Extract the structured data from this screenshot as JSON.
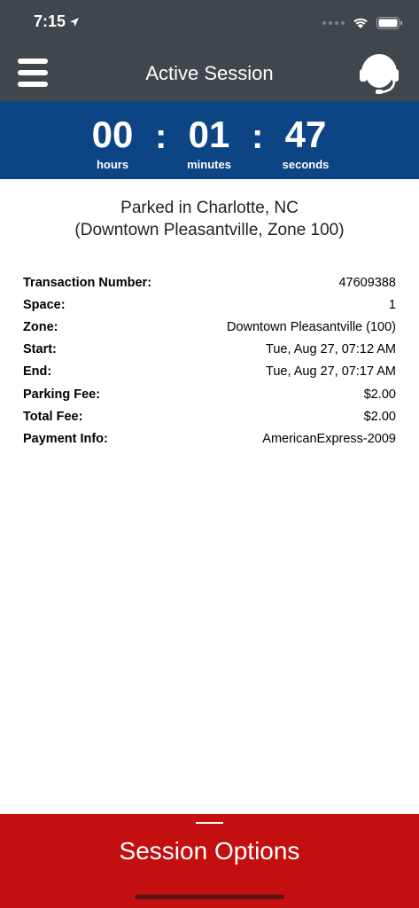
{
  "status_bar": {
    "time": "7:15",
    "icons": [
      "location-arrow-icon",
      "cellular-dots-icon",
      "wifi-icon",
      "battery-icon"
    ]
  },
  "header": {
    "title": "Active Session",
    "left_icon": "hamburger-menu-icon",
    "right_icon": "headset-support-icon",
    "background": "#3f464c"
  },
  "timer": {
    "hours": "00",
    "hours_label": "hours",
    "minutes": "01",
    "minutes_label": "minutes",
    "seconds": "47",
    "seconds_label": "seconds",
    "separator": ":",
    "background": "#0d4584"
  },
  "location": {
    "line1": "Parked in Charlotte, NC",
    "line2": "(Downtown Pleasantville, Zone 100)"
  },
  "details": [
    {
      "label": "Transaction Number:",
      "value": "47609388"
    },
    {
      "label": "Space:",
      "value": "1"
    },
    {
      "label": "Zone:",
      "value": "Downtown Pleasantville (100)"
    },
    {
      "label": "Start:",
      "value": "Tue, Aug 27, 07:12 AM"
    },
    {
      "label": "End:",
      "value": "Tue, Aug 27, 07:17 AM"
    },
    {
      "label": "Parking Fee:",
      "value": "$2.00"
    },
    {
      "label": "Total Fee:",
      "value": "$2.00"
    },
    {
      "label": "Payment Info:",
      "value": "AmericanExpress-2009"
    }
  ],
  "session_options": {
    "label": "Session Options",
    "background": "#c30f0f"
  }
}
